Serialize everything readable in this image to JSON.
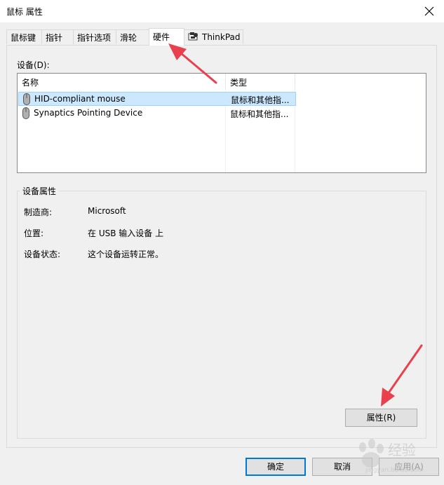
{
  "window": {
    "title": "鼠标 属性"
  },
  "tabs": [
    {
      "label": "鼠标键"
    },
    {
      "label": "指针"
    },
    {
      "label": "指针选项"
    },
    {
      "label": "滑轮"
    },
    {
      "label": "硬件",
      "active": true
    },
    {
      "label": "ThinkPad",
      "icon": "thinkpad-icon"
    }
  ],
  "hardware": {
    "devices_label": "设备(D):",
    "columns": [
      "名称",
      "类型"
    ],
    "devices": [
      {
        "name": "HID-compliant mouse",
        "type": "鼠标和其他指...",
        "icon": "mouse-icon",
        "selected": true
      },
      {
        "name": "Synaptics Pointing Device",
        "type": "鼠标和其他指...",
        "icon": "mouse-icon",
        "selected": false
      }
    ],
    "properties_group": {
      "title": "设备属性",
      "fields": [
        {
          "label": "制造商:",
          "value": "Microsoft"
        },
        {
          "label": "位置:",
          "value": "在 USB 输入设备 上"
        },
        {
          "label": "设备状态:",
          "value": "这个设备运转正常。"
        }
      ]
    },
    "properties_button": "属性(R)"
  },
  "footer": {
    "ok_label": "确定",
    "cancel_label": "取消",
    "apply_label": "应用(A)"
  },
  "watermark": {
    "text": "经验",
    "subtext": "jingyan.baidu.com"
  },
  "colors": {
    "selection": "#cce8ff",
    "annotation_arrow": "#e8404c",
    "default_button_border": "#0078d7"
  }
}
